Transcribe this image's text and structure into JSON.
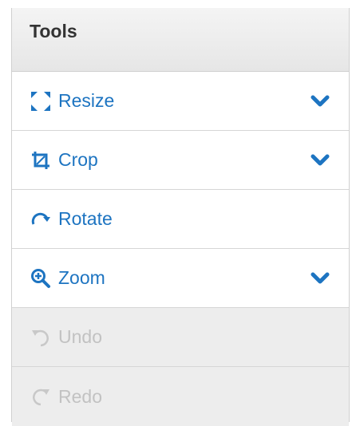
{
  "panel": {
    "title": "Tools"
  },
  "tools": [
    {
      "label": "Resize",
      "icon": "resize-icon",
      "expandable": true,
      "enabled": true
    },
    {
      "label": "Crop",
      "icon": "crop-icon",
      "expandable": true,
      "enabled": true
    },
    {
      "label": "Rotate",
      "icon": "rotate-icon",
      "expandable": false,
      "enabled": true
    },
    {
      "label": "Zoom",
      "icon": "zoom-in-icon",
      "expandable": true,
      "enabled": true
    },
    {
      "label": "Undo",
      "icon": "undo-icon",
      "expandable": false,
      "enabled": false
    },
    {
      "label": "Redo",
      "icon": "redo-icon",
      "expandable": false,
      "enabled": false
    }
  ],
  "colors": {
    "accent": "#1d74c1",
    "disabled_text": "#c2c2c2",
    "header_bg": "#ececec"
  }
}
